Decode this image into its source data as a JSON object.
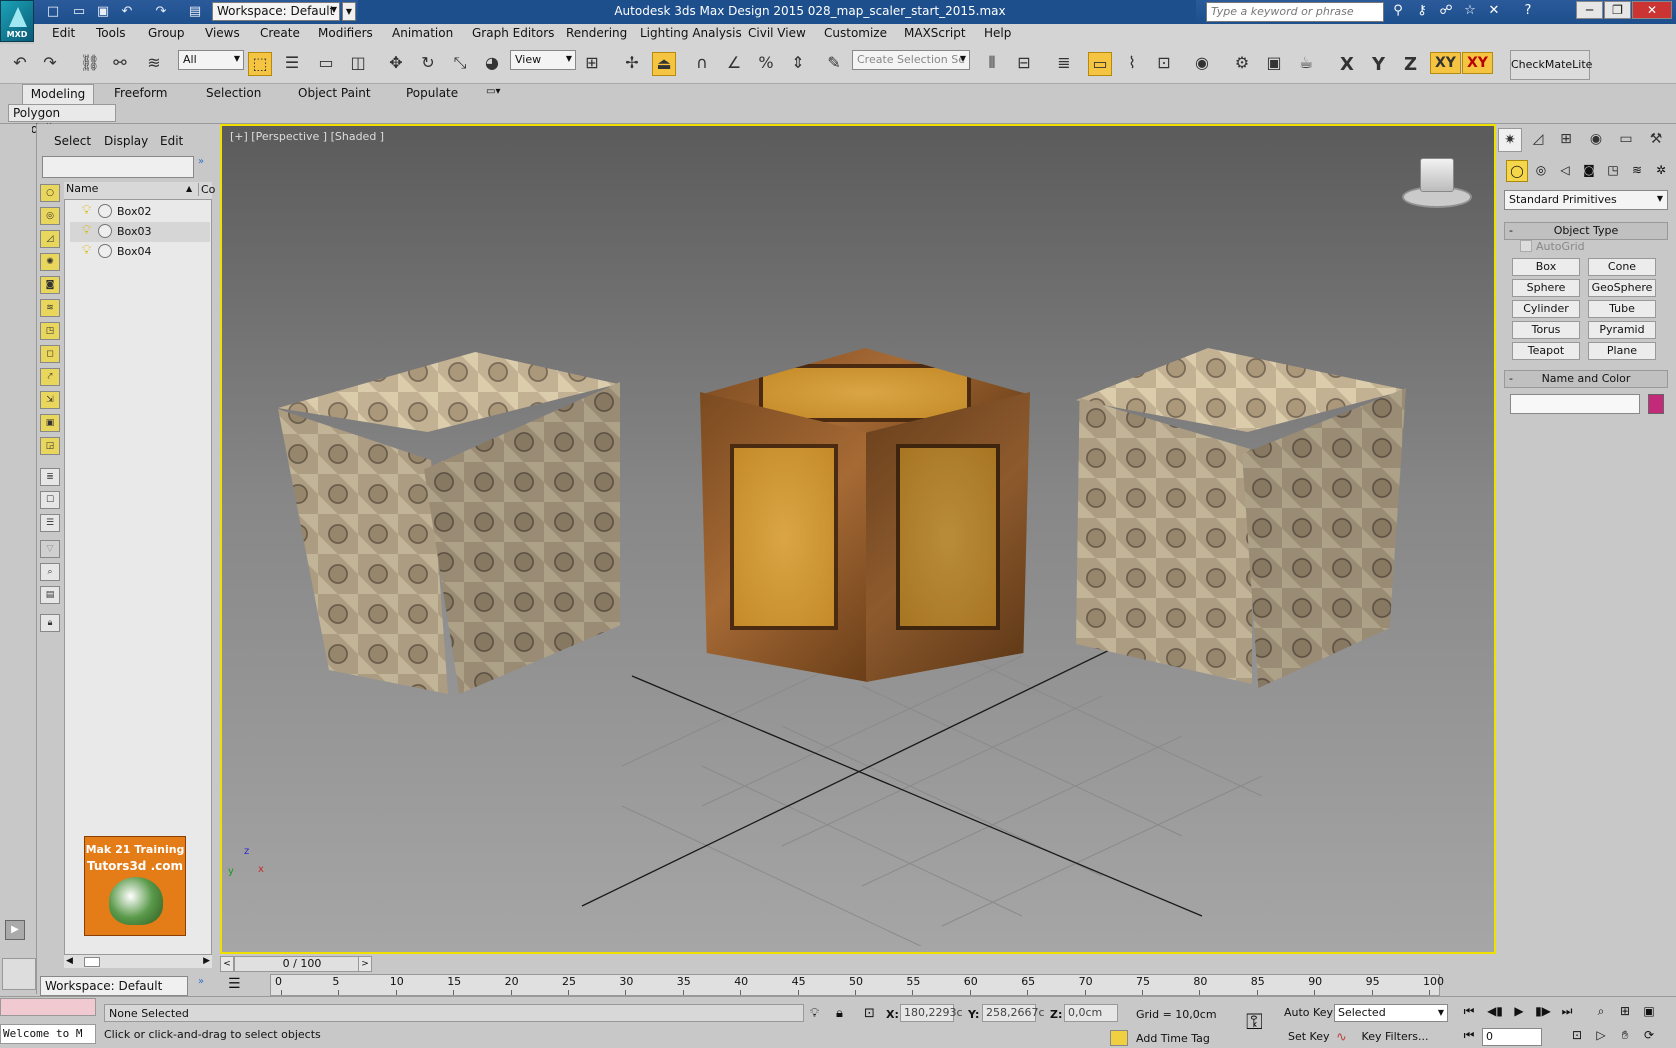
{
  "title": {
    "app_title": "Autodesk 3ds Max Design 2015     028_map_scaler_start_2015.max",
    "workspace": "Workspace: Default",
    "logo": "MXD",
    "search_placeholder": "Type a keyword or phrase"
  },
  "menu": [
    "Edit",
    "Tools",
    "Group",
    "Views",
    "Create",
    "Modifiers",
    "Animation",
    "Graph Editors",
    "Rendering",
    "Lighting Analysis",
    "Civil View",
    "Customize",
    "MAXScript",
    "Help"
  ],
  "toolbar": {
    "filter": "All",
    "refcoord": "View",
    "selection_set": "Create Selection Se",
    "axes": [
      "X",
      "Y",
      "Z",
      "XY",
      "XY"
    ],
    "checkmate": "CheckMateLite"
  },
  "ribbon": {
    "tabs": [
      "Modeling",
      "Freeform",
      "Selection",
      "Object Paint",
      "Populate"
    ],
    "panel": "Polygon Modeling"
  },
  "scene_explorer": {
    "menu": [
      "Select",
      "Display",
      "Edit"
    ],
    "col_name": "Name",
    "col2": "Co",
    "items": [
      "Box02",
      "Box03",
      "Box04"
    ],
    "workspace": "Workspace: Default"
  },
  "logo_box": {
    "line1": "Mak 21 Training",
    "line2": "Tutors3d .com"
  },
  "viewport": {
    "label": "[+] [Perspective ] [Shaded ]"
  },
  "timeline": {
    "frame": "0 / 100",
    "ticks": [
      0,
      5,
      10,
      15,
      20,
      25,
      30,
      35,
      40,
      45,
      50,
      55,
      60,
      65,
      70,
      75,
      80,
      85,
      90,
      95,
      100
    ]
  },
  "status": {
    "listener": "Welcome to M",
    "line1": "None Selected",
    "line2": "Click or click-and-drag to select objects",
    "x_label": "X:",
    "x_value": "180,2293c",
    "y_label": "Y:",
    "y_value": "258,2667c",
    "z_label": "Z:",
    "z_value": "0,0cm",
    "grid": "Grid = 10,0cm",
    "add_time_tag": "Add Time Tag",
    "auto_key": "Auto Key",
    "set_key": "Set Key",
    "selected": "Selected",
    "key_filters": "Key Filters...",
    "frame": "0"
  },
  "command_panel": {
    "category": "Standard Primitives",
    "object_type": "Object Type",
    "autogrid": "AutoGrid",
    "buttons": [
      "Box",
      "Cone",
      "Sphere",
      "GeoSphere",
      "Cylinder",
      "Tube",
      "Torus",
      "Pyramid",
      "Teapot",
      "Plane"
    ],
    "name_color": "Name and Color",
    "swatch_color": "#c42a7a"
  }
}
